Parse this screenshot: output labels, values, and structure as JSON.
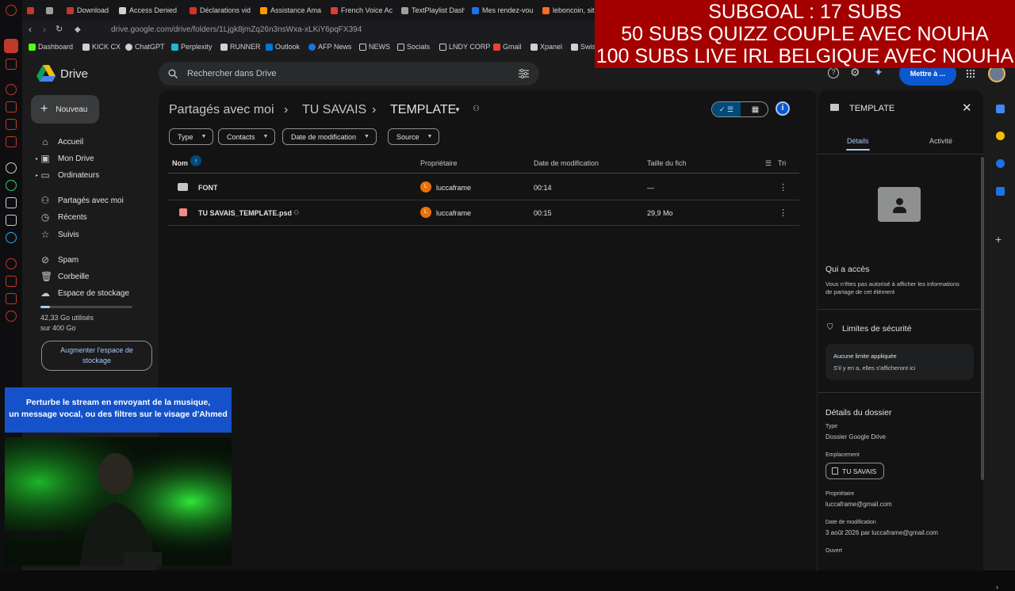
{
  "browser": {
    "tabs": [
      {
        "label": "",
        "color": "#c0392b"
      },
      {
        "label": "",
        "color": "#9e9e9e"
      },
      {
        "label": "Download",
        "color": "#c0392b"
      },
      {
        "label": "Access Denied",
        "color": "#d0d0d0"
      },
      {
        "label": "Déclarations vid",
        "color": "#d93025"
      },
      {
        "label": "Assistance Ama",
        "color": "#ff9900"
      },
      {
        "label": "French Voice Ac",
        "color": "#e53935"
      },
      {
        "label": "TextPlaylist Dash",
        "color": "#9e9e9e"
      },
      {
        "label": "Mes rendez-vou",
        "color": "#1a73e8"
      },
      {
        "label": "leboncoin, sit",
        "color": "#ff6e14"
      }
    ],
    "url": "drive.google.com/drive/folders/1Ljgk8jmZq26n3nsWxa-xLKiY6pqFX394",
    "bookmarks": [
      {
        "label": "Dashboard",
        "color": "#53fc18"
      },
      {
        "label": "KICK CX",
        "color": "#d0d0d0"
      },
      {
        "label": "ChatGPT",
        "color": "#d0d0d0"
      },
      {
        "label": "Perplexity",
        "color": "#20b8cd"
      },
      {
        "label": "RUNNER",
        "color": "#d0d0d0"
      },
      {
        "label": "Outlook",
        "color": "#0078d4"
      },
      {
        "label": "AFP News",
        "color": "#1a73e8"
      },
      {
        "label": "NEWS",
        "color": "#d0d0d0"
      },
      {
        "label": "Socials",
        "color": "#d0d0d0"
      },
      {
        "label": "LNDY CORP",
        "color": "#d0d0d0"
      },
      {
        "label": "Gmail",
        "color": "#ea4335"
      },
      {
        "label": "Xpanel",
        "color": "#d0d0d0"
      },
      {
        "label": "Swis",
        "color": "#d0d0d0"
      }
    ]
  },
  "overlay": {
    "line1": "SUBGOAL : 17 SUBS",
    "line2": "50 SUBS QUIZZ COUPLE AVEC NOUHA",
    "line3": "100 SUBS LIVE IRL BELGIQUE AVEC NOUHA",
    "banner_line1": "Perturbe le stream en envoyant de la musique,",
    "banner_line2": "un message vocal, ou des filtres sur le visage d'Ahmed",
    "colors": {
      "subgoal_bg": "#a40000",
      "banner_bg": "#1552c9"
    }
  },
  "drive": {
    "app_name": "Drive",
    "search_placeholder": "Rechercher dans Drive",
    "share_button": "Mettre à ...",
    "new_button": "Nouveau",
    "nav": [
      {
        "label": "Accueil",
        "icon": "home-icon"
      },
      {
        "label": "Mon Drive",
        "icon": "my-drive-icon"
      },
      {
        "label": "Ordinateurs",
        "icon": "computers-icon"
      },
      {
        "label": "Partagés avec moi",
        "icon": "shared-icon"
      },
      {
        "label": "Récents",
        "icon": "clock-icon"
      },
      {
        "label": "Suivis",
        "icon": "star-icon"
      },
      {
        "label": "Spam",
        "icon": "spam-icon"
      },
      {
        "label": "Corbeille",
        "icon": "trash-icon"
      },
      {
        "label": "Espace de stockage",
        "icon": "cloud-icon"
      }
    ],
    "storage": {
      "used": "42,33 Go utilisés",
      "total": "sur 400 Go",
      "fraction": 0.106
    },
    "upgrade_button_line1": "Augmenter l'espace de",
    "upgrade_button_line2": "stockage",
    "breadcrumb": [
      "Partagés avec moi",
      "TU SAVAIS",
      "TEMPLATE"
    ],
    "filters": [
      "Type",
      "Contacts",
      "Date de modification",
      "Source"
    ],
    "columns": {
      "name": "Nom",
      "owner": "Propriétaire",
      "modified": "Date de modification",
      "size": "Taille du fich",
      "sort": "Tri"
    },
    "files": [
      {
        "name": "FONT",
        "type": "folder",
        "owner": "luccaframe",
        "owner_initial": "L",
        "modified": "00:14",
        "size": "—",
        "shared": false
      },
      {
        "name": "TU SAVAIS_TEMPLATE.psd",
        "type": "image",
        "owner": "luccaframe",
        "owner_initial": "L",
        "modified": "00:15",
        "size": "29,9 Mo",
        "shared": true
      }
    ]
  },
  "details": {
    "title": "TEMPLATE",
    "tab_details": "Détails",
    "tab_activity": "Activité",
    "access_title": "Qui a accès",
    "access_text_line1": "Vous n'êtes pas autorisé à afficher les informations",
    "access_text_line2": "de partage de cet élément",
    "security_title": "Limites de sécurité",
    "security_box_title": "Aucune limite appliquée",
    "security_box_text": "S'il y en a, elles s'afficheront ici",
    "folder_details_title": "Détails du dossier",
    "type_label": "Type",
    "type_value": "Dossier Google Drive",
    "location_label": "Emplacement",
    "location_value": "TU SAVAIS",
    "owner_label": "Propriétaire",
    "owner_value": "luccaframe@gmail.com",
    "modified_label": "Date de modification",
    "modified_value": "3 août 2026 par luccaframe@gmail.com",
    "opened_label": "Ouvert"
  }
}
